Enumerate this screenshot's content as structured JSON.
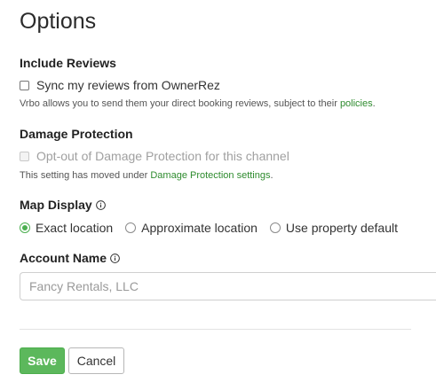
{
  "page_title": "Options",
  "include_reviews": {
    "heading": "Include Reviews",
    "checkbox_label": "Sync my reviews from OwnerRez",
    "help_text": "Vrbo allows you to send them your direct booking reviews, subject to their ",
    "help_link": "policies",
    "help_suffix": "."
  },
  "damage_protection": {
    "heading": "Damage Protection",
    "checkbox_label": "Opt-out of Damage Protection for this channel",
    "help_text": "This setting has moved under ",
    "help_link": "Damage Protection settings",
    "help_suffix": "."
  },
  "map_display": {
    "heading": "Map Display",
    "options": [
      {
        "label": "Exact location",
        "selected": true
      },
      {
        "label": "Approximate location",
        "selected": false
      },
      {
        "label": "Use property default",
        "selected": false
      }
    ]
  },
  "account_name": {
    "heading": "Account Name",
    "placeholder": "Fancy Rentals, LLC"
  },
  "buttons": {
    "save": "Save",
    "cancel": "Cancel"
  },
  "colors": {
    "accent": "#5cb85c",
    "link": "#2e8b2e"
  }
}
